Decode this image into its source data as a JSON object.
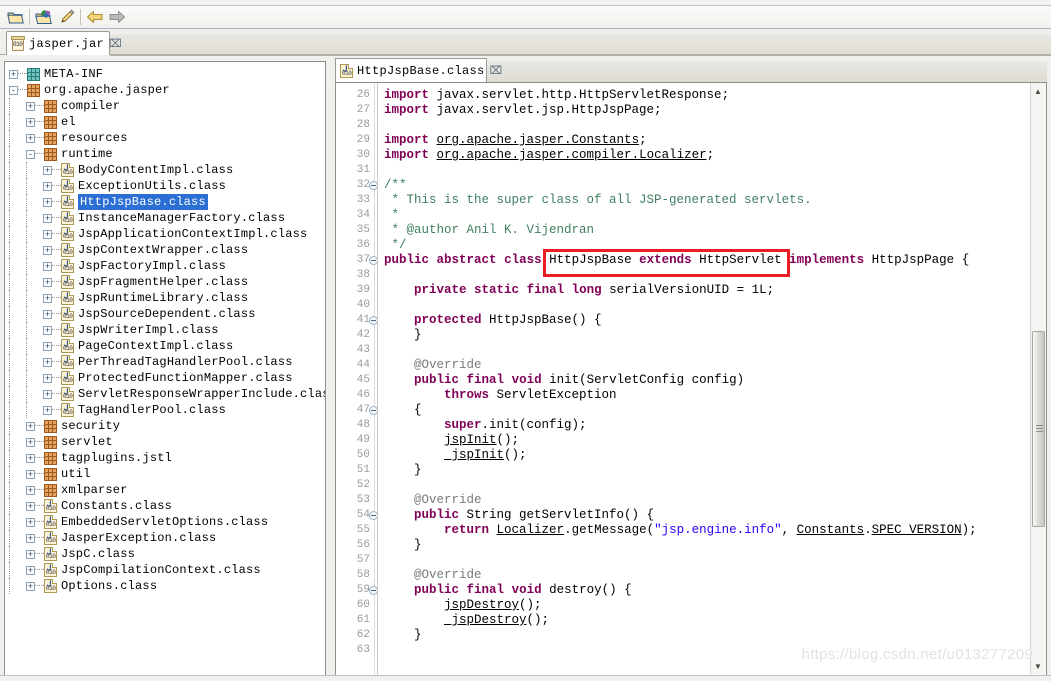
{
  "window": {
    "toolbar_buttons": [
      {
        "name": "open-folder-icon",
        "title": "Open"
      },
      {
        "name": "open-project-icon",
        "title": "Open Project"
      },
      {
        "name": "pencil-icon",
        "title": "Edit"
      },
      {
        "name": "back-arrow-icon",
        "title": "Back"
      },
      {
        "name": "forward-arrow-icon",
        "title": "Forward"
      }
    ]
  },
  "jar_tab": {
    "label": "jasper.jar",
    "close_glyph": "⌧",
    "icon": "jar-icon"
  },
  "tree": {
    "items": [
      {
        "label": "META-INF",
        "indent": 0,
        "icon": "package-icon-teal",
        "expander": "+",
        "selected": false
      },
      {
        "label": "org.apache.jasper",
        "indent": 0,
        "icon": "package-icon",
        "expander": "-",
        "selected": false
      },
      {
        "label": "compiler",
        "indent": 1,
        "icon": "package-icon",
        "expander": "+",
        "selected": false
      },
      {
        "label": "el",
        "indent": 1,
        "icon": "package-icon",
        "expander": "+",
        "selected": false
      },
      {
        "label": "resources",
        "indent": 1,
        "icon": "package-icon",
        "expander": "+",
        "selected": false
      },
      {
        "label": "runtime",
        "indent": 1,
        "icon": "package-icon",
        "expander": "-",
        "selected": false
      },
      {
        "label": "BodyContentImpl.class",
        "indent": 2,
        "icon": "class-icon",
        "expander": "+",
        "selected": false
      },
      {
        "label": "ExceptionUtils.class",
        "indent": 2,
        "icon": "class-icon",
        "expander": "+",
        "selected": false
      },
      {
        "label": "HttpJspBase.class",
        "indent": 2,
        "icon": "class-icon",
        "expander": "+",
        "selected": true
      },
      {
        "label": "InstanceManagerFactory.class",
        "indent": 2,
        "icon": "class-icon",
        "expander": "+",
        "selected": false
      },
      {
        "label": "JspApplicationContextImpl.class",
        "indent": 2,
        "icon": "class-icon",
        "expander": "+",
        "selected": false
      },
      {
        "label": "JspContextWrapper.class",
        "indent": 2,
        "icon": "class-icon",
        "expander": "+",
        "selected": false
      },
      {
        "label": "JspFactoryImpl.class",
        "indent": 2,
        "icon": "class-icon",
        "expander": "+",
        "selected": false
      },
      {
        "label": "JspFragmentHelper.class",
        "indent": 2,
        "icon": "class-icon",
        "expander": "+",
        "selected": false
      },
      {
        "label": "JspRuntimeLibrary.class",
        "indent": 2,
        "icon": "class-icon",
        "expander": "+",
        "selected": false
      },
      {
        "label": "JspSourceDependent.class",
        "indent": 2,
        "icon": "class-icon",
        "expander": "+",
        "selected": false
      },
      {
        "label": "JspWriterImpl.class",
        "indent": 2,
        "icon": "class-icon",
        "expander": "+",
        "selected": false
      },
      {
        "label": "PageContextImpl.class",
        "indent": 2,
        "icon": "class-icon",
        "expander": "+",
        "selected": false
      },
      {
        "label": "PerThreadTagHandlerPool.class",
        "indent": 2,
        "icon": "class-icon",
        "expander": "+",
        "selected": false
      },
      {
        "label": "ProtectedFunctionMapper.class",
        "indent": 2,
        "icon": "class-icon",
        "expander": "+",
        "selected": false
      },
      {
        "label": "ServletResponseWrapperInclude.class",
        "indent": 2,
        "icon": "class-icon",
        "expander": "+",
        "selected": false
      },
      {
        "label": "TagHandlerPool.class",
        "indent": 2,
        "icon": "class-icon",
        "expander": "+",
        "selected": false
      },
      {
        "label": "security",
        "indent": 1,
        "icon": "package-icon",
        "expander": "+",
        "selected": false
      },
      {
        "label": "servlet",
        "indent": 1,
        "icon": "package-icon",
        "expander": "+",
        "selected": false
      },
      {
        "label": "tagplugins.jstl",
        "indent": 1,
        "icon": "package-icon",
        "expander": "+",
        "selected": false
      },
      {
        "label": "util",
        "indent": 1,
        "icon": "package-icon",
        "expander": "+",
        "selected": false
      },
      {
        "label": "xmlparser",
        "indent": 1,
        "icon": "package-icon",
        "expander": "+",
        "selected": false
      },
      {
        "label": "Constants.class",
        "indent": 1,
        "icon": "class-icon",
        "expander": "+",
        "selected": false
      },
      {
        "label": "EmbeddedServletOptions.class",
        "indent": 1,
        "icon": "class-icon",
        "expander": "+",
        "selected": false
      },
      {
        "label": "JasperException.class",
        "indent": 1,
        "icon": "class-icon",
        "expander": "+",
        "selected": false
      },
      {
        "label": "JspC.class",
        "indent": 1,
        "icon": "class-icon",
        "expander": "+",
        "selected": false
      },
      {
        "label": "JspCompilationContext.class",
        "indent": 1,
        "icon": "class-icon",
        "expander": "+",
        "selected": false
      },
      {
        "label": "Options.class",
        "indent": 1,
        "icon": "class-icon",
        "expander": "+",
        "selected": false
      }
    ]
  },
  "editor": {
    "tab": {
      "label": "HttpJspBase.class",
      "close_glyph": "⌧",
      "icon": "class-icon"
    },
    "first_line_number": 26,
    "lines": [
      {
        "n": 26,
        "fold": "",
        "html": "<span class=\"kw\">import</span> javax.servlet.http.HttpServletResponse;"
      },
      {
        "n": 27,
        "fold": "",
        "html": "<span class=\"kw\">import</span> javax.servlet.jsp.HttpJspPage;"
      },
      {
        "n": 28,
        "fold": "",
        "html": ""
      },
      {
        "n": 29,
        "fold": "",
        "html": "<span class=\"kw\">import</span> <span class=\"un\">org.apache.jasper.Constants</span>;"
      },
      {
        "n": 30,
        "fold": "",
        "html": "<span class=\"kw\">import</span> <span class=\"un\">org.apache.jasper.compiler.Localizer</span>;"
      },
      {
        "n": 31,
        "fold": "",
        "html": ""
      },
      {
        "n": 32,
        "fold": "-",
        "html": "<span class=\"cm\">/**</span>"
      },
      {
        "n": 33,
        "fold": "",
        "html": "<span class=\"cm\"> * This is the super class of all JSP-generated servlets.</span>"
      },
      {
        "n": 34,
        "fold": "",
        "html": "<span class=\"cm\"> *</span>"
      },
      {
        "n": 35,
        "fold": "",
        "html": "<span class=\"cm\"> * @author Anil K. Vijendran</span>"
      },
      {
        "n": 36,
        "fold": "",
        "html": "<span class=\"cm\"> */</span>"
      },
      {
        "n": 37,
        "fold": "-",
        "html": "<span class=\"kw\">public</span> <span class=\"kw\">abstract</span> <span class=\"kw\">class</span> HttpJspBase <span class=\"kw\">extends</span> HttpServlet <span class=\"kw\">implements</span> HttpJspPage {"
      },
      {
        "n": 38,
        "fold": "",
        "html": ""
      },
      {
        "n": 39,
        "fold": "",
        "html": "    <span class=\"kw\">private</span> <span class=\"kw\">static</span> <span class=\"kw\">final</span> <span class=\"kw\">long</span> serialVersionUID = 1L;"
      },
      {
        "n": 40,
        "fold": "",
        "html": ""
      },
      {
        "n": 41,
        "fold": "-",
        "html": "    <span class=\"kw\">protected</span> HttpJspBase() {"
      },
      {
        "n": 42,
        "fold": "",
        "html": "    }"
      },
      {
        "n": 43,
        "fold": "",
        "html": ""
      },
      {
        "n": 44,
        "fold": "",
        "html": "    <span class=\"an\">@Override</span>"
      },
      {
        "n": 45,
        "fold": "",
        "html": "    <span class=\"kw\">public</span> <span class=\"kw\">final</span> <span class=\"kw\">void</span> init(ServletConfig config)"
      },
      {
        "n": 46,
        "fold": "",
        "html": "        <span class=\"kw\">throws</span> ServletException"
      },
      {
        "n": 47,
        "fold": "-",
        "html": "    {"
      },
      {
        "n": 48,
        "fold": "",
        "html": "        <span class=\"kw\">super</span>.init(config);"
      },
      {
        "n": 49,
        "fold": "",
        "html": "        <span class=\"un\">jspInit</span>();"
      },
      {
        "n": 50,
        "fold": "",
        "html": "        <span class=\"un\">_jspInit</span>();"
      },
      {
        "n": 51,
        "fold": "",
        "html": "    }"
      },
      {
        "n": 52,
        "fold": "",
        "html": ""
      },
      {
        "n": 53,
        "fold": "",
        "html": "    <span class=\"an\">@Override</span>"
      },
      {
        "n": 54,
        "fold": "-",
        "html": "    <span class=\"kw\">public</span> String getServletInfo() {"
      },
      {
        "n": 55,
        "fold": "",
        "html": "        <span class=\"kw\">return</span> <span class=\"un\">Localizer</span>.getMessage(<span class=\"st\">\"jsp.engine.info\"</span>, <span class=\"un\">Constants</span>.<span class=\"un\">SPEC_VERSION</span>);"
      },
      {
        "n": 56,
        "fold": "",
        "html": "    }"
      },
      {
        "n": 57,
        "fold": "",
        "html": ""
      },
      {
        "n": 58,
        "fold": "",
        "html": "    <span class=\"an\">@Override</span>"
      },
      {
        "n": 59,
        "fold": "-",
        "html": "    <span class=\"kw\">public</span> <span class=\"kw\">final</span> <span class=\"kw\">void</span> destroy() {"
      },
      {
        "n": 60,
        "fold": "",
        "html": "        <span class=\"un\">jspDestroy</span>();"
      },
      {
        "n": 61,
        "fold": "",
        "html": "        <span class=\"un\">_jspDestroy</span>();"
      },
      {
        "n": 62,
        "fold": "",
        "html": "    }"
      },
      {
        "n": 63,
        "fold": "",
        "html": ""
      }
    ],
    "plain_lines": [
      "import javax.servlet.http.HttpServletResponse;",
      "import javax.servlet.jsp.HttpJspPage;",
      "",
      "import org.apache.jasper.Constants;",
      "import org.apache.jasper.compiler.Localizer;",
      "",
      "/**",
      " * This is the super class of all JSP-generated servlets.",
      " *",
      " * @author Anil K. Vijendran",
      " */",
      "public abstract class HttpJspBase extends HttpServlet implements HttpJspPage {",
      "",
      "    private static final long serialVersionUID = 1L;",
      "",
      "    protected HttpJspBase() {",
      "    }",
      "",
      "    @Override",
      "    public final void init(ServletConfig config)",
      "        throws ServletException",
      "    {",
      "        super.init(config);",
      "        jspInit();",
      "        _jspInit();",
      "    }",
      "",
      "    @Override",
      "    public String getServletInfo() {",
      "        return Localizer.getMessage(\"jsp.engine.info\", Constants.SPEC_VERSION);",
      "    }",
      "",
      "    @Override",
      "    public final void destroy() {",
      "        jspDestroy();",
      "        _jspDestroy();",
      "    }",
      ""
    ],
    "highlight": {
      "text": "HttpJspBase extends HttpServlet",
      "color": "#ea1c24",
      "line": 37
    },
    "scrollbar": {
      "up_glyph": "▲",
      "down_glyph": "▼"
    }
  },
  "watermark": {
    "text": "https://blog.csdn.net/u013277209"
  },
  "colors": {
    "selection": "#2b6fd4",
    "keyword": "#7f0055",
    "comment": "#3f7f5f",
    "annotation": "#7a7a7a",
    "string": "#2a00ff",
    "highlight": "#ea1c24"
  }
}
